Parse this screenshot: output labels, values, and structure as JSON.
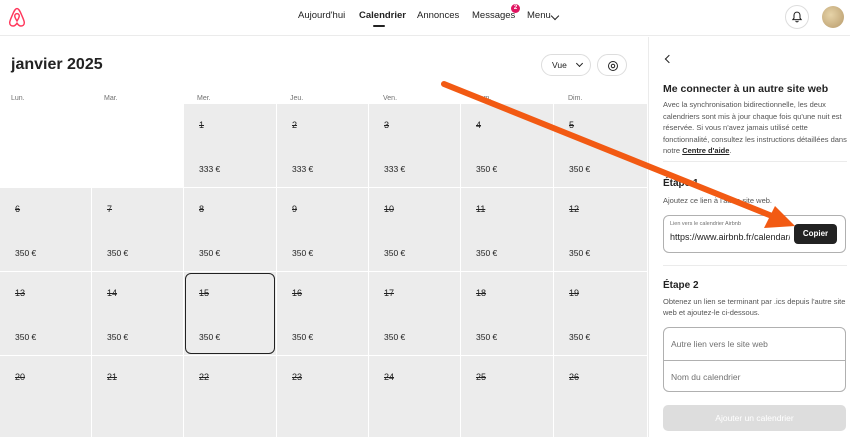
{
  "nav": {
    "items": [
      "Aujourd'hui",
      "Calendrier",
      "Annonces",
      "Messages",
      "Menu"
    ],
    "messages_badge": "2"
  },
  "calendar": {
    "title": "janvier 2025",
    "view_label": "Vue",
    "weekdays": [
      "Lun.",
      "Mar.",
      "Mer.",
      "Jeu.",
      "Ven.",
      "Sam.",
      "Dim."
    ],
    "weeks": [
      [
        null,
        null,
        {
          "day": "1",
          "price": "333 €"
        },
        {
          "day": "2",
          "price": "333 €"
        },
        {
          "day": "3",
          "price": "333 €"
        },
        {
          "day": "4",
          "price": "350 €"
        },
        {
          "day": "5",
          "price": "350 €"
        }
      ],
      [
        {
          "day": "6",
          "price": "350 €"
        },
        {
          "day": "7",
          "price": "350 €"
        },
        {
          "day": "8",
          "price": "350 €"
        },
        {
          "day": "9",
          "price": "350 €"
        },
        {
          "day": "10",
          "price": "350 €"
        },
        {
          "day": "11",
          "price": "350 €"
        },
        {
          "day": "12",
          "price": "350 €"
        }
      ],
      [
        {
          "day": "13",
          "price": "350 €"
        },
        {
          "day": "14",
          "price": "350 €"
        },
        {
          "day": "15",
          "price": "350 €",
          "today": true
        },
        {
          "day": "16",
          "price": "350 €"
        },
        {
          "day": "17",
          "price": "350 €"
        },
        {
          "day": "18",
          "price": "350 €"
        },
        {
          "day": "19",
          "price": "350 €"
        }
      ],
      [
        {
          "day": "20",
          "price": ""
        },
        {
          "day": "21",
          "price": ""
        },
        {
          "day": "22",
          "price": ""
        },
        {
          "day": "23",
          "price": ""
        },
        {
          "day": "24",
          "price": ""
        },
        {
          "day": "25",
          "price": ""
        },
        {
          "day": "26",
          "price": ""
        }
      ]
    ]
  },
  "panel": {
    "title": "Me connecter à un autre site web",
    "description": "Avec la synchronisation bidirectionnelle, les deux calendriers sont mis à jour chaque fois qu'une nuit est réservée. Si vous n'avez jamais utilisé cette fonctionnalité, consultez les instructions détaillées dans notre ",
    "help_link": "Centre d'aide",
    "step1_title": "Étape 1",
    "step1_desc": "Ajoutez ce lien à l'autre site web.",
    "link_label": "Lien vers le calendrier Airbnb",
    "link_value": "https://www.airbnb.fr/calendar/ical",
    "copy_label": "Copier",
    "step2_title": "Étape 2",
    "step2_desc": "Obtenez un lien se terminant par .ics depuis l'autre site web et ajoutez-le ci-dessous.",
    "other_link_placeholder": "Autre lien vers le site web",
    "calendar_name_placeholder": "Nom du calendrier",
    "add_label": "Ajouter un calendrier"
  },
  "colors": {
    "brand": "#ff385c",
    "arrow": "#f25a13",
    "badge": "#e01561"
  }
}
